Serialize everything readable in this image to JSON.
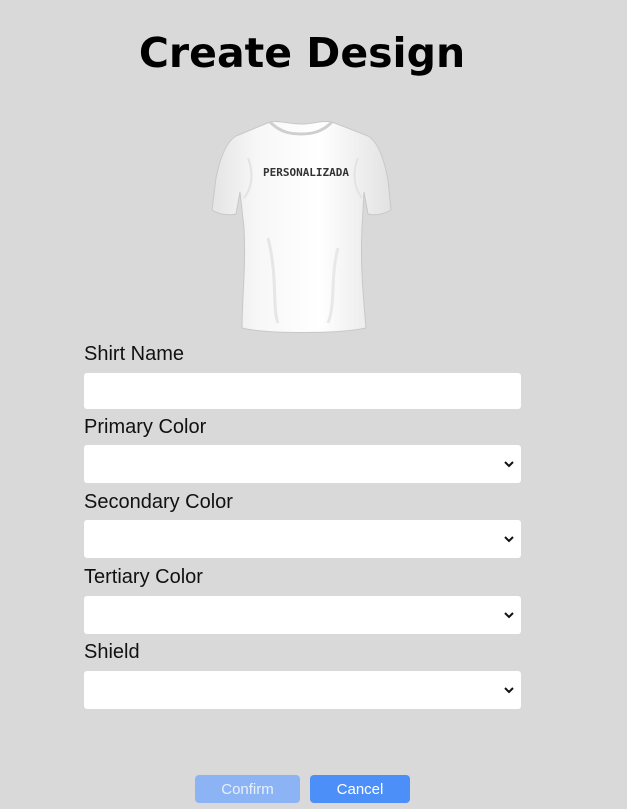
{
  "page": {
    "title": "Create Design"
  },
  "preview": {
    "shirt_print_text": "PERSONALIZADA",
    "shirt_color": "#ffffff"
  },
  "form": {
    "shirt_name": {
      "label": "Shirt Name",
      "value": "",
      "placeholder": ""
    },
    "primary_color": {
      "label": "Primary Color",
      "value": ""
    },
    "secondary_color": {
      "label": "Secondary Color",
      "value": ""
    },
    "tertiary_color": {
      "label": "Tertiary Color",
      "value": ""
    },
    "shield": {
      "label": "Shield",
      "value": ""
    }
  },
  "actions": {
    "confirm_label": "Confirm",
    "cancel_label": "Cancel"
  },
  "colors": {
    "background": "#d9d9d9",
    "confirm_button": "#8cb4f5",
    "cancel_button": "#4d8ff8"
  }
}
